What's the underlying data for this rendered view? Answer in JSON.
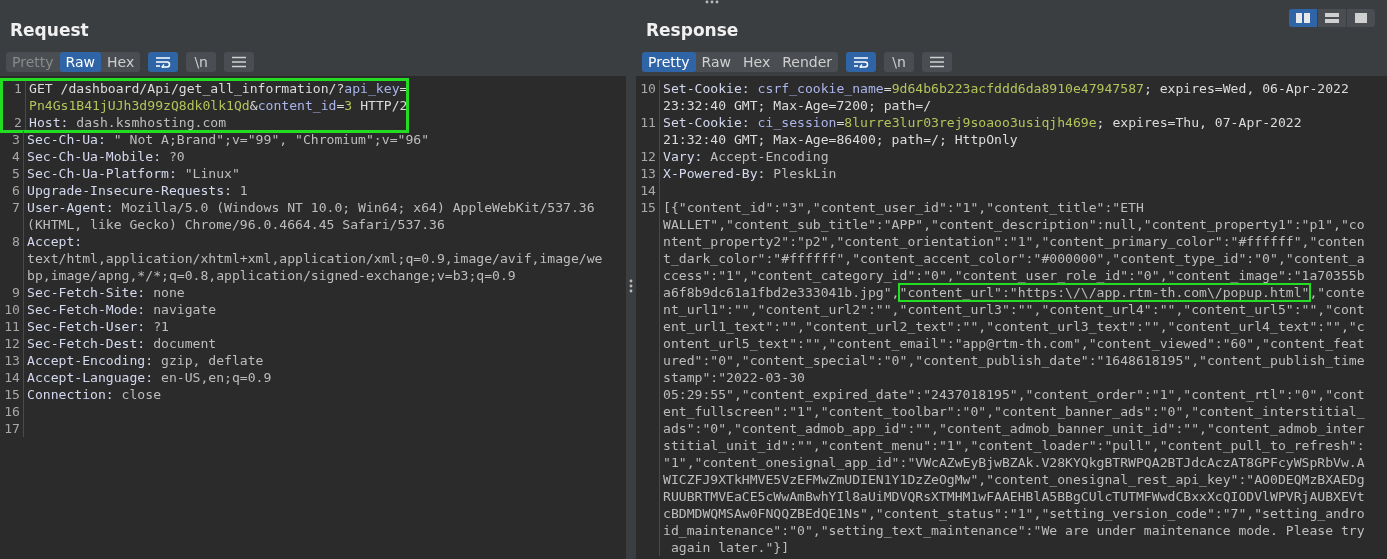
{
  "layout_buttons": [
    {
      "kind": "columns",
      "selected": true
    },
    {
      "kind": "rows",
      "selected": false
    },
    {
      "kind": "single",
      "selected": false
    }
  ],
  "panels": [
    {
      "title": "Request",
      "tabs": [
        {
          "label": "Pretty",
          "selected": false,
          "disabled": true
        },
        {
          "label": "Raw",
          "selected": true,
          "disabled": false
        },
        {
          "label": "Hex",
          "selected": false,
          "disabled": false
        }
      ],
      "tools": [
        {
          "kind": "wrap",
          "selected": true
        },
        {
          "kind": "newline",
          "label": "\\n",
          "selected": false
        },
        {
          "kind": "menu",
          "selected": false
        }
      ],
      "lines": [
        {
          "number": "1",
          "highlighted": true,
          "wraps": [
            {
              "parts": [
                {
                  "text": "GET /dashboard/Api/get_all_information/?",
                  "kind": "text"
                },
                {
                  "text": "api_key",
                  "kind": "key"
                },
                {
                  "text": "=",
                  "kind": "text"
                }
              ]
            },
            {
              "parts": [
                {
                  "text": "Pn4Gs1B41jUJh3d99zQ8dk0lk1Qd",
                  "kind": "val"
                },
                {
                  "text": "&",
                  "kind": "text"
                },
                {
                  "text": "content_id",
                  "kind": "key"
                },
                {
                  "text": "=",
                  "kind": "text"
                },
                {
                  "text": "3",
                  "kind": "val"
                },
                {
                  "text": " HTTP/2",
                  "kind": "text"
                }
              ]
            }
          ]
        },
        {
          "number": "2",
          "highlighted": true,
          "wraps": [
            {
              "parts": [
                {
                  "text": "Host:",
                  "kind": "name"
                },
                {
                  "text": " dash.ksmhosting.com",
                  "kind": "hval"
                }
              ]
            }
          ]
        },
        {
          "number": "3",
          "highlighted": false,
          "wraps": [
            {
              "parts": [
                {
                  "text": "Sec-Ch-Ua:",
                  "kind": "name"
                },
                {
                  "text": " \" Not A;Brand\";v=\"99\", \"Chromium\";v=\"96\"",
                  "kind": "hval"
                }
              ]
            }
          ]
        },
        {
          "number": "4",
          "highlighted": false,
          "wraps": [
            {
              "parts": [
                {
                  "text": "Sec-Ch-Ua-Mobile:",
                  "kind": "name"
                },
                {
                  "text": " ?0",
                  "kind": "hval"
                }
              ]
            }
          ]
        },
        {
          "number": "5",
          "highlighted": false,
          "wraps": [
            {
              "parts": [
                {
                  "text": "Sec-Ch-Ua-Platform:",
                  "kind": "name"
                },
                {
                  "text": " \"Linux\"",
                  "kind": "hval"
                }
              ]
            }
          ]
        },
        {
          "number": "6",
          "highlighted": false,
          "wraps": [
            {
              "parts": [
                {
                  "text": "Upgrade-Insecure-Requests:",
                  "kind": "name"
                },
                {
                  "text": " 1",
                  "kind": "hval"
                }
              ]
            }
          ]
        },
        {
          "number": "7",
          "highlighted": false,
          "wraps": [
            {
              "parts": [
                {
                  "text": "User-Agent:",
                  "kind": "name"
                },
                {
                  "text": " Mozilla/5.0 (Windows NT 10.0; Win64; x64) AppleWebKit/537.36",
                  "kind": "hval"
                }
              ]
            },
            {
              "parts": [
                {
                  "text": "(KHTML, like Gecko) Chrome/96.0.4664.45 Safari/537.36",
                  "kind": "hval"
                }
              ]
            }
          ]
        },
        {
          "number": "8",
          "highlighted": false,
          "wraps": [
            {
              "parts": [
                {
                  "text": "Accept:",
                  "kind": "name"
                }
              ]
            },
            {
              "parts": [
                {
                  "text": "text/html,application/xhtml+xml,application/xml;q=0.9,image/avif,image/we",
                  "kind": "hval"
                }
              ]
            },
            {
              "parts": [
                {
                  "text": "bp,image/apng,*/*;q=0.8,application/signed-exchange;v=b3;q=0.9",
                  "kind": "hval"
                }
              ]
            }
          ]
        },
        {
          "number": "9",
          "highlighted": false,
          "wraps": [
            {
              "parts": [
                {
                  "text": "Sec-Fetch-Site:",
                  "kind": "name"
                },
                {
                  "text": " none",
                  "kind": "hval"
                }
              ]
            }
          ]
        },
        {
          "number": "10",
          "highlighted": false,
          "wraps": [
            {
              "parts": [
                {
                  "text": "Sec-Fetch-Mode:",
                  "kind": "name"
                },
                {
                  "text": " navigate",
                  "kind": "hval"
                }
              ]
            }
          ]
        },
        {
          "number": "11",
          "highlighted": false,
          "wraps": [
            {
              "parts": [
                {
                  "text": "Sec-Fetch-User:",
                  "kind": "name"
                },
                {
                  "text": " ?1",
                  "kind": "hval"
                }
              ]
            }
          ]
        },
        {
          "number": "12",
          "highlighted": false,
          "wraps": [
            {
              "parts": [
                {
                  "text": "Sec-Fetch-Dest:",
                  "kind": "name"
                },
                {
                  "text": " document",
                  "kind": "hval"
                }
              ]
            }
          ]
        },
        {
          "number": "13",
          "highlighted": false,
          "wraps": [
            {
              "parts": [
                {
                  "text": "Accept-Encoding:",
                  "kind": "name"
                },
                {
                  "text": " gzip, deflate",
                  "kind": "hval"
                }
              ]
            }
          ]
        },
        {
          "number": "14",
          "highlighted": false,
          "wraps": [
            {
              "parts": [
                {
                  "text": "Accept-Language:",
                  "kind": "name"
                },
                {
                  "text": " en-US,en;q=0.9",
                  "kind": "hval"
                }
              ]
            }
          ]
        },
        {
          "number": "15",
          "highlighted": false,
          "wraps": [
            {
              "parts": [
                {
                  "text": "Connection:",
                  "kind": "name"
                },
                {
                  "text": " close",
                  "kind": "hval"
                }
              ]
            }
          ]
        },
        {
          "number": "16",
          "highlighted": false
        },
        {
          "number": "17",
          "highlighted": false
        }
      ]
    },
    {
      "title": "Response",
      "tabs": [
        {
          "label": "Pretty",
          "selected": true,
          "disabled": false
        },
        {
          "label": "Raw",
          "selected": false,
          "disabled": false
        },
        {
          "label": "Hex",
          "selected": false,
          "disabled": false
        },
        {
          "label": "Render",
          "selected": false,
          "disabled": false
        }
      ],
      "tools": [
        {
          "kind": "wrap",
          "selected": true
        },
        {
          "kind": "newline",
          "label": "\\n",
          "selected": false
        },
        {
          "kind": "menu",
          "selected": false
        }
      ],
      "lines": [
        {
          "number": "10",
          "highlighted": false,
          "wraps": [
            {
              "parts": [
                {
                  "text": "Set-Cookie: ",
                  "kind": "name"
                },
                {
                  "text": "csrf_cookie_name",
                  "kind": "key"
                },
                {
                  "text": "=",
                  "kind": "text"
                },
                {
                  "text": "9d64b6b223acfddd6da8910e47947587",
                  "kind": "val"
                },
                {
                  "text": "; expires=Wed, 06-Apr-2022",
                  "kind": "text"
                }
              ]
            },
            {
              "parts": [
                {
                  "text": "23:32:40 GMT; Max-Age=7200; path=/",
                  "kind": "text"
                }
              ]
            }
          ]
        },
        {
          "number": "11",
          "highlighted": false,
          "wraps": [
            {
              "parts": [
                {
                  "text": "Set-Cookie: ",
                  "kind": "name"
                },
                {
                  "text": "ci_session",
                  "kind": "key"
                },
                {
                  "text": "=",
                  "kind": "text"
                },
                {
                  "text": "8lurre3lur03rej9soaoo3usiqjh469e",
                  "kind": "val"
                },
                {
                  "text": "; expires=Thu, 07-Apr-2022",
                  "kind": "text"
                }
              ]
            },
            {
              "parts": [
                {
                  "text": "21:32:40 GMT; Max-Age=86400; path=/; HttpOnly",
                  "kind": "text"
                }
              ]
            }
          ]
        },
        {
          "number": "12",
          "highlighted": false,
          "wraps": [
            {
              "parts": [
                {
                  "text": "Vary:",
                  "kind": "name"
                },
                {
                  "text": " Accept-Encoding",
                  "kind": "hval"
                }
              ]
            }
          ]
        },
        {
          "number": "13",
          "highlighted": false,
          "wraps": [
            {
              "parts": [
                {
                  "text": "X-Powered-By:",
                  "kind": "name"
                },
                {
                  "text": " PleskLin",
                  "kind": "hval"
                }
              ]
            }
          ]
        },
        {
          "number": "14",
          "highlighted": false
        },
        {
          "number": "15",
          "highlighted": false,
          "wraps": [
            {
              "parts": [
                {
                  "text": "[{\"content_id\":\"3\",\"content_user_id\":\"1\",\"content_title\":\"ETH",
                  "kind": "hval"
                }
              ]
            },
            {
              "parts": [
                {
                  "text": "WALLET\",\"content_sub_title\":\"APP\",\"content_description\":null,\"content_property1\":\"p1\",\"co",
                  "kind": "hval"
                }
              ]
            },
            {
              "parts": [
                {
                  "text": "ntent_property2\":\"p2\",\"content_orientation\":\"1\",\"content_primary_color\":\"#ffffff\",\"conten",
                  "kind": "hval"
                }
              ]
            },
            {
              "parts": [
                {
                  "text": "t_dark_color\":\"#ffffff\",\"content_accent_color\":\"#000000\",\"content_type_id\":\"0\",\"content_a",
                  "kind": "hval"
                }
              ]
            },
            {
              "parts": [
                {
                  "text": "ccess\":\"1\",\"content_category_id\":\"0\",\"content_user_role_id\":\"0\",\"content_image\":\"1a70355b",
                  "kind": "hval"
                }
              ]
            },
            {
              "parts": [
                {
                  "text": "a6f8b9dc61a1fbd2e333041b.jpg\",",
                  "kind": "hval"
                },
                {
                  "text": "\"content_url\":\"https:\\/\\/app.rtm-th.com\\/popup.html\"",
                  "kind": "hval",
                  "highlighted": true
                },
                {
                  "text": ",\"conte",
                  "kind": "hval"
                }
              ]
            },
            {
              "parts": [
                {
                  "text": "nt_url1\":\"\",\"content_url2\":\"\",\"content_url3\":\"\",\"content_url4\":\"\",\"content_url5\":\"\",\"cont",
                  "kind": "hval"
                }
              ]
            },
            {
              "parts": [
                {
                  "text": "ent_url1_text\":\"\",\"content_url2_text\":\"\",\"content_url3_text\":\"\",\"content_url4_text\":\"\",\"c",
                  "kind": "hval"
                }
              ]
            },
            {
              "parts": [
                {
                  "text": "ontent_url5_text\":\"\",\"content_email\":\"app@rtm-th.com\",\"content_viewed\":\"60\",\"content_feat",
                  "kind": "hval"
                }
              ]
            },
            {
              "parts": [
                {
                  "text": "ured\":\"0\",\"content_special\":\"0\",\"content_publish_date\":\"1648618195\",\"content_publish_time",
                  "kind": "hval"
                }
              ]
            },
            {
              "parts": [
                {
                  "text": "stamp\":\"2022-03-30",
                  "kind": "hval"
                }
              ]
            },
            {
              "parts": [
                {
                  "text": "05:29:55\",\"content_expired_date\":\"2437018195\",\"content_order\":\"1\",\"content_rtl\":\"0\",\"cont",
                  "kind": "hval"
                }
              ]
            },
            {
              "parts": [
                {
                  "text": "ent_fullscreen\":\"1\",\"content_toolbar\":\"0\",\"content_banner_ads\":\"0\",\"content_interstitial_",
                  "kind": "hval"
                }
              ]
            },
            {
              "parts": [
                {
                  "text": "ads\":\"0\",\"content_admob_app_id\":\"\",\"content_admob_banner_unit_id\":\"\",\"content_admob_inter",
                  "kind": "hval"
                }
              ]
            },
            {
              "parts": [
                {
                  "text": "stitial_unit_id\":\"\",\"content_menu\":\"1\",\"content_loader\":\"pull\",\"content_pull_to_refresh\":",
                  "kind": "hval"
                }
              ]
            },
            {
              "parts": [
                {
                  "text": "\"1\",\"content_onesignal_app_id\":\"VWcAZwEyBjwBZAk.V28KYQkgBTRWPQA2BTJdcAczAT8GPFcyWSpRbVw.A",
                  "kind": "hval"
                }
              ]
            },
            {
              "parts": [
                {
                  "text": "WICZFJ9XTkHMVE5VzEFMwZmUDIEN1Y1DzZeOgMw\",\"content_onesignal_rest_api_key\":\"AO0DEQMzBXAEDg",
                  "kind": "hval"
                }
              ]
            },
            {
              "parts": [
                {
                  "text": "RUUBRTMVEaCE5cWwAmBwhYIl8aUiMDVQRsXTMHM1wFAAEHBlA5BBgCUlcTUTMFWwdCBxxXcQIODVlWPVRjAUBXEVt",
                  "kind": "hval"
                }
              ]
            },
            {
              "parts": [
                {
                  "text": "cBDMDWQMSAw0FNQQZBEdQE1Ns\",\"content_status\":\"1\",\"setting_version_code\":\"7\",\"setting_andro",
                  "kind": "hval"
                }
              ]
            },
            {
              "parts": [
                {
                  "text": "id_maintenance\":\"0\",\"setting_text_maintenance\":\"We are under maintenance mode. Please try",
                  "kind": "hval"
                }
              ]
            },
            {
              "parts": [
                {
                  "text": " again later.\"}]",
                  "kind": "hval"
                }
              ]
            }
          ]
        }
      ]
    }
  ]
}
